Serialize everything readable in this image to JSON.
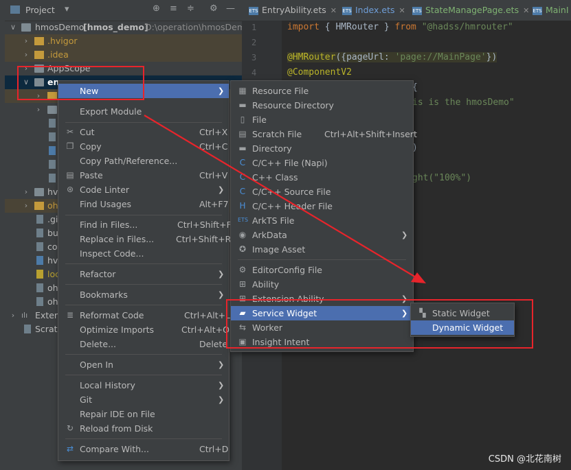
{
  "project": {
    "title": "Project",
    "tree": [
      {
        "label": "hmosDemo",
        "bold": "[hmos_demo]",
        "path": "D:\\operation\\hmosDemo"
      },
      {
        "label": ".hvigor"
      },
      {
        "label": ".idea"
      },
      {
        "label": "AppScope"
      },
      {
        "label": "en"
      },
      {
        "label": "hv"
      },
      {
        "label": "oh"
      },
      {
        "label": ".gi"
      },
      {
        "label": "bu"
      },
      {
        "label": "co"
      },
      {
        "label": "hv"
      },
      {
        "label": "loc"
      },
      {
        "label": "oh"
      },
      {
        "label": "oh"
      },
      {
        "label": "Extern"
      },
      {
        "label": "Scrato"
      }
    ]
  },
  "editor": {
    "tabs": [
      {
        "label": "EntryAbility.ets",
        "icon": "ETS"
      },
      {
        "label": "Index.ets",
        "icon": "ETS"
      },
      {
        "label": "StateManagePage.ets",
        "icon": "ETS"
      },
      {
        "label": "MainI",
        "icon": "ETS"
      }
    ],
    "line_numbers": [
      "1",
      "2",
      "3",
      "4"
    ],
    "code": {
      "l1_kw": "import",
      "l1_mid": " { HMRouter } ",
      "l1_from": "from",
      "l1_str": "\"@hadss/hmrouter\"",
      "l3_ann": "@HMRouter",
      "l3_p1": "({",
      "l3_key": "pageUrl",
      "l3_colon": ": ",
      "l3_str": "'page://MainPage'",
      "l3_p2": "})",
      "l4_ann": "@ComponentV2",
      "l5": "{",
      "l6": "is is the hmosDemo\"",
      "l8": ")",
      "l10": "ght(\"100%\")"
    }
  },
  "context_menu": {
    "items": [
      {
        "label": "New",
        "submenu": true
      },
      {
        "label": "Export Module"
      },
      {
        "label": "Cut",
        "shortcut": "Ctrl+X",
        "icon": "cut-icon"
      },
      {
        "label": "Copy",
        "shortcut": "Ctrl+C",
        "icon": "copy-icon"
      },
      {
        "label": "Copy Path/Reference..."
      },
      {
        "label": "Paste",
        "shortcut": "Ctrl+V",
        "icon": "paste-icon"
      },
      {
        "label": "Code Linter",
        "submenu": true,
        "icon": "code-linter-icon"
      },
      {
        "label": "Find Usages",
        "shortcut": "Alt+F7"
      },
      {
        "label": "Find in Files...",
        "shortcut": "Ctrl+Shift+F"
      },
      {
        "label": "Replace in Files...",
        "shortcut": "Ctrl+Shift+R"
      },
      {
        "label": "Inspect Code..."
      },
      {
        "label": "Refactor",
        "submenu": true
      },
      {
        "label": "Bookmarks",
        "submenu": true
      },
      {
        "label": "Reformat Code",
        "shortcut": "Ctrl+Alt+L",
        "icon": "reformat-icon"
      },
      {
        "label": "Optimize Imports",
        "shortcut": "Ctrl+Alt+O"
      },
      {
        "label": "Delete...",
        "shortcut": "Delete"
      },
      {
        "label": "Open In",
        "submenu": true
      },
      {
        "label": "Local History",
        "submenu": true
      },
      {
        "label": "Git",
        "submenu": true
      },
      {
        "label": "Repair IDE on File"
      },
      {
        "label": "Reload from Disk",
        "icon": "reload-icon"
      },
      {
        "label": "Compare With...",
        "shortcut": "Ctrl+D",
        "icon": "compare-icon"
      }
    ]
  },
  "new_submenu": {
    "items": [
      {
        "label": "Resource File"
      },
      {
        "label": "Resource Directory"
      },
      {
        "label": "File"
      },
      {
        "label": "Scratch File",
        "shortcut": "Ctrl+Alt+Shift+Insert"
      },
      {
        "label": "Directory"
      },
      {
        "label": "C/C++ File (Napi)"
      },
      {
        "label": "C++ Class"
      },
      {
        "label": "C/C++ Source File"
      },
      {
        "label": "C/C++ Header File"
      },
      {
        "label": "ArkTS File"
      },
      {
        "label": "ArkData",
        "submenu": true
      },
      {
        "label": "Image Asset"
      },
      {
        "label": "EditorConfig File"
      },
      {
        "label": "Ability"
      },
      {
        "label": "Extension Ability",
        "submenu": true
      },
      {
        "label": "Service Widget",
        "submenu": true
      },
      {
        "label": "Worker"
      },
      {
        "label": "Insight Intent"
      }
    ]
  },
  "widget_submenu": {
    "items": [
      {
        "label": "Static Widget"
      },
      {
        "label": "Dynamic Widget"
      }
    ]
  },
  "watermark": "CSDN @北花南树",
  "colors": {
    "highlight_box": "#e8242b",
    "selection": "#4b6eaf",
    "annotation_arrow": "#e8242b"
  }
}
